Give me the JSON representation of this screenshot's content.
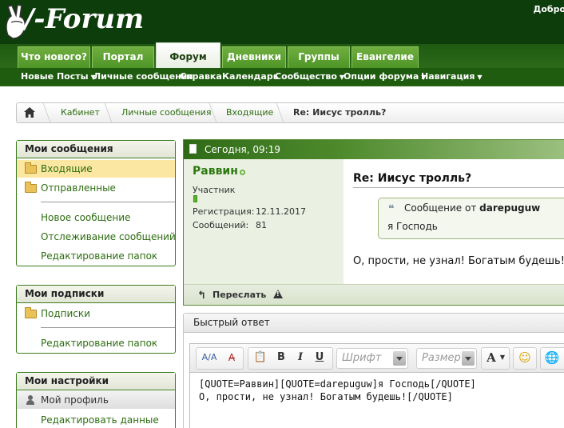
{
  "header": {
    "logo_text": "/-Forum",
    "welcome": "Добро"
  },
  "tabs": [
    {
      "label": "Что нового?"
    },
    {
      "label": "Портал"
    },
    {
      "label": "Форум"
    },
    {
      "label": "Дневники"
    },
    {
      "label": "Группы"
    },
    {
      "label": "Евангелие"
    }
  ],
  "subnav": [
    {
      "label": "Новые Посты"
    },
    {
      "label": "Личные сообщения"
    },
    {
      "label": "Справка"
    },
    {
      "label": "Календарь"
    },
    {
      "label": "Сообщество"
    },
    {
      "label": "Опции форума"
    },
    {
      "label": "Навигация"
    }
  ],
  "breadcrumb": [
    {
      "label": "Кабинет"
    },
    {
      "label": "Личные сообщения"
    },
    {
      "label": "Входящие"
    },
    {
      "label": "Re: Иисус тролль?"
    }
  ],
  "sidebar": {
    "messages": {
      "title": "Мои сообщения",
      "folders": [
        "Входящие",
        "Отправленные"
      ],
      "links": [
        "Новое сообщение",
        "Отслеживание сообщений",
        "Редактирование папок"
      ]
    },
    "subscriptions": {
      "title": "Мои подписки",
      "folders": [
        "Подписки"
      ],
      "links": [
        "Редактирование папок"
      ]
    },
    "settings": {
      "title": "Мои настройки",
      "profile": "Мой профиль",
      "links": [
        "Редактировать данные"
      ]
    }
  },
  "post": {
    "date": "Сегодня, 09:19",
    "username": "Раввин",
    "user_title": "Участник",
    "reg_label": "Регистрация:",
    "reg_value": "12.11.2017",
    "posts_label": "Сообщений:",
    "posts_value": "81",
    "title": "Re: Иисус тролль?",
    "quote_prefix": "Сообщение от",
    "quote_author": "darepuguw",
    "quote_text": "я Господь",
    "message": "О, прости, не узнал! Богатым будешь!",
    "forward": "Переслать"
  },
  "quick_reply": {
    "title": "Быстрый ответ",
    "font_placeholder": "Шрифт",
    "size_placeholder": "Размер",
    "text": "[QUOTE=Раввин][QUOTE=darepuguw]я Господь[/QUOTE]\nО, прости, не узнал! Богатым будешь![/QUOTE]"
  },
  "colors": {
    "header_bg": "#0d3d0b",
    "tab_green": "#5a9e2f",
    "link_green": "#2d6d10",
    "selected_folder": "#fbe7a1"
  }
}
